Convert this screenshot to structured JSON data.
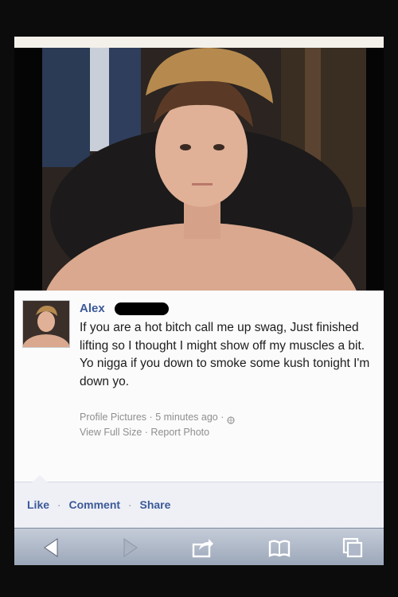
{
  "post": {
    "author": "Alex",
    "message": "If you are a hot bitch call me up swag, Just finished lifting so I thought I might show off my muscles a bit. Yo nigga if you down to smoke some kush tonight I'm down yo.",
    "album": "Profile Pictures",
    "time": "5 minutes ago",
    "view_full": "View Full Size",
    "report": "Report Photo",
    "separator": "·"
  },
  "actions": {
    "like": "Like",
    "comment": "Comment",
    "share": "Share",
    "separator": "·"
  },
  "toolbar": {
    "icons": [
      "back-arrow-icon",
      "forward-arrow-icon",
      "share-icon",
      "bookmarks-icon",
      "tabs-icon"
    ]
  },
  "colors": {
    "link_blue": "#3b5998",
    "meta_gray": "#8f8f8f",
    "toolbar_top": "#c5ccd8",
    "toolbar_bottom": "#9aa6b8"
  }
}
